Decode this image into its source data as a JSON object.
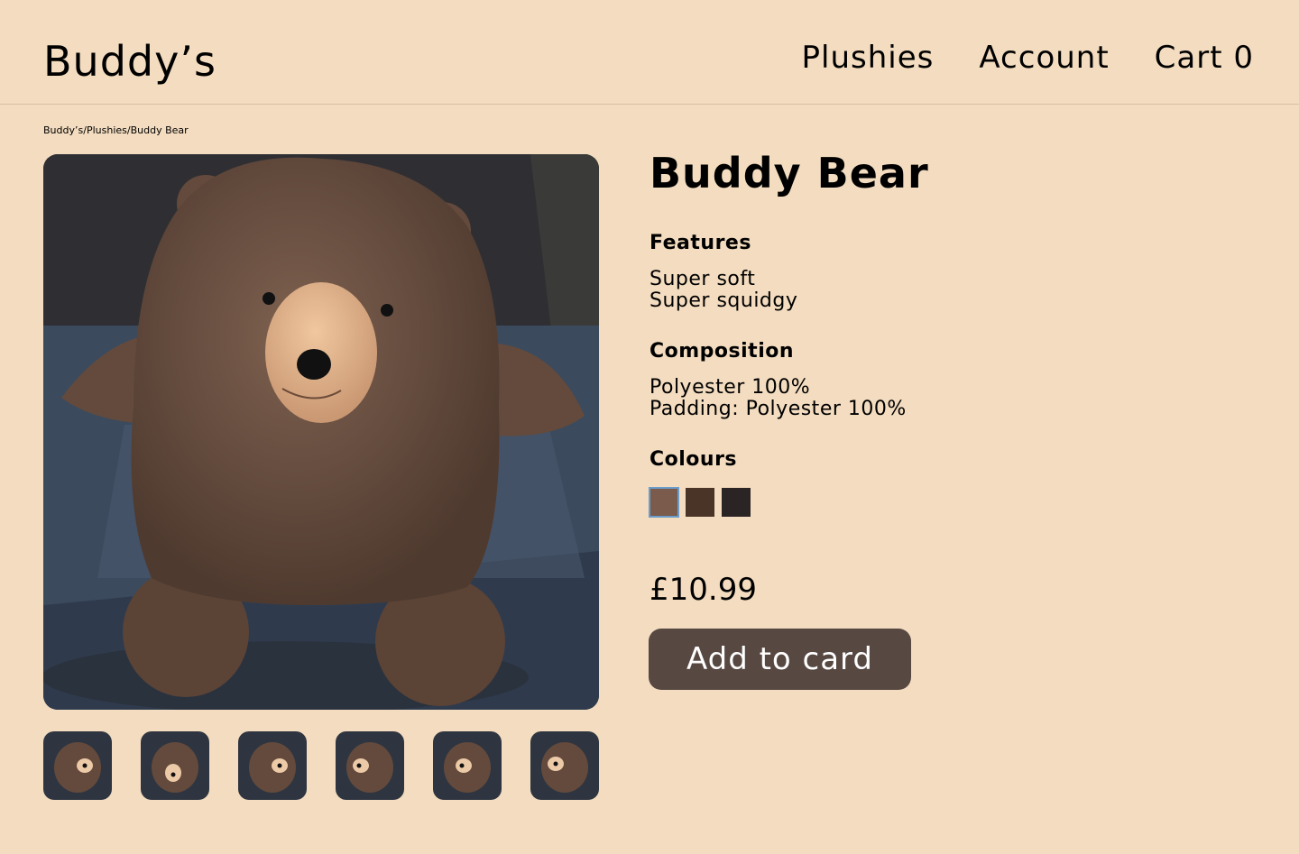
{
  "header": {
    "logo": "Buddy’s",
    "nav": [
      {
        "label": "Plushies"
      },
      {
        "label": "Account"
      },
      {
        "label": "Cart 0"
      }
    ]
  },
  "breadcrumb": {
    "items": [
      "Buddy’s",
      "Plushies",
      "Buddy Bear"
    ],
    "separator": "/"
  },
  "product": {
    "title": "Buddy Bear",
    "features_heading": "Features",
    "features": [
      "Super soft",
      "Super squidgy"
    ],
    "composition_heading": "Composition",
    "composition": [
      "Polyester 100%",
      "Padding: Polyester 100%"
    ],
    "colours_heading": "Colours",
    "colours": [
      "#7b5b4b",
      "#4a3428",
      "#2a2424"
    ],
    "selected_colour": 0,
    "price": "£10.99",
    "add_button": "Add to card",
    "thumbnail_count": 6
  },
  "colors": {
    "background": "#f3dcbf",
    "button": "#574842",
    "selected_outline": "#6a9ccc"
  }
}
